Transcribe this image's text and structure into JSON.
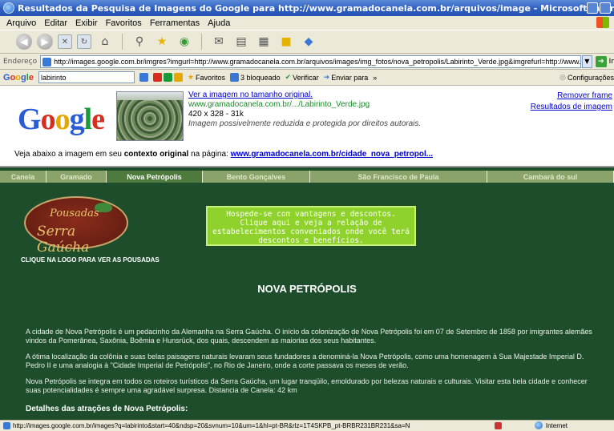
{
  "window": {
    "title": "Resultados da Pesquisa de Imagens do Google para http://www.gramadocanela.com.br/arquivos/image - Microsoft Internet Explorer"
  },
  "menu": {
    "items": [
      "Arquivo",
      "Editar",
      "Exibir",
      "Favoritos",
      "Ferramentas",
      "Ajuda"
    ]
  },
  "address": {
    "label": "Endereço",
    "url": "http://images.google.com.br/imgres?imgurl=http://www.gramadocanela.com.br/arquivos/images/img_fotos/nova_petropolis/Labirinto_Verde.jpg&imgrefurl=http://www.gran",
    "go_label": "Ir"
  },
  "google_toolbar": {
    "logo": "Google",
    "query": "labirinto",
    "favoritos": "Favoritos",
    "bloqueado": "3 bloqueado",
    "verificar": "Verificar",
    "enviar": "Enviar para",
    "configuracoes": "Configurações"
  },
  "result": {
    "logo": "Google",
    "view_full": "Ver a imagem no tamanho original.",
    "source_url": "www.gramadocanela.com.br/.../Labirinto_Verde.jpg",
    "dimensions": "420 x 328 - 31k",
    "note": "Imagem possivelmente reduzida e protegida por direitos autorais.",
    "remove_frame": "Remover frame",
    "results_link": "Resultados de imagem",
    "context_pre": "Veja abaixo a imagem em seu ",
    "context_bold": "contexto original",
    "context_mid": " na página: ",
    "context_link": "www.gramadocanela.com.br/cidade_nova_petropol..."
  },
  "site": {
    "nav": [
      "Canela",
      "Gramado",
      "Nova Petrópolis",
      "Bento Gonçalves",
      "São Francisco de Paula",
      "Cambará do sul"
    ],
    "logo_line1": "Pousadas",
    "logo_line2": "Serra Gaúcha",
    "logo_caption": "CLIQUE NA LOGO PARA VER AS POUSADAS",
    "promo": "Hospede-se com vantagens e descontos. Clique aqui e veja a relação de estabelecimentos conveniados onde você terá descontos e benefícios.",
    "heading": "NOVA PETRÓPOLIS",
    "paragraphs": [
      "A cidade de Nova Petrópolis é um pedacinho da Alemanha na Serra Gaúcha. O início da colonização de Nova Petrópolis foi em 07 de Setembro de 1858 por imigrantes alemães vindos da Pomerânea, Saxônia, Boêmia e Hunsrück, dos quais, descendem as maiorias dos seus habitantes.",
      "A ótima localização da colônia e suas belas paisagens naturais levaram seus fundadores a denominá-la Nova Petrópolis, como uma homenagem à Sua Majestade Imperial D. Pedro II e uma analogia à \"Cidade Imperial de Petrópolis\", no Rio de Janeiro, onde a corte passava os meses de verão.",
      "Nova Petrópolis se integra em todos os roteiros turísticos da Serra Gaúcha, um lugar tranqüilo, emoldurado por belezas naturais e culturais. Visitar esta bela cidade e conhecer suas potencialidades é sempre uma agradável surpresa. Distancia de Canela: 42 km"
    ],
    "details_heading": "Detalhes das atrações de Nova Petrópolis:"
  },
  "status": {
    "text": "http://images.google.com.br/images?q=labirinto&start=40&ndsp=20&svnum=10&um=1&hl=pt-BR&rlz=1T4SKPB_pt-BRBR231BR231&sa=N",
    "zone": "Internet"
  }
}
